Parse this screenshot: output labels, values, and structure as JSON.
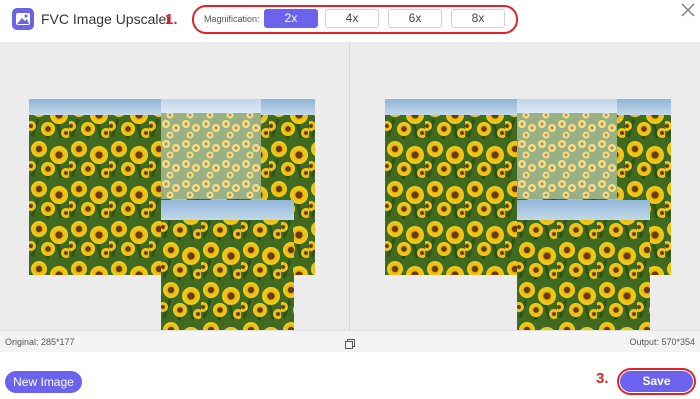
{
  "app": {
    "title": "FVC Image Upscaler",
    "logo_icon": "image-upscale-icon"
  },
  "toolbar": {
    "magnification_label": "Magnification:",
    "options": [
      {
        "label": "2x",
        "selected": true
      },
      {
        "label": "4x",
        "selected": false
      },
      {
        "label": "6x",
        "selected": false
      },
      {
        "label": "8x",
        "selected": false
      }
    ],
    "step_marker": "1."
  },
  "status": {
    "original": "Original: 285*177",
    "output": "Output: 570*354"
  },
  "footer": {
    "new_image_label": "New Image",
    "save_label": "Save",
    "save_step_marker": "3."
  },
  "colors": {
    "accent": "#6b62ee",
    "highlight": "#e1222b",
    "marker": "#d8232a"
  }
}
